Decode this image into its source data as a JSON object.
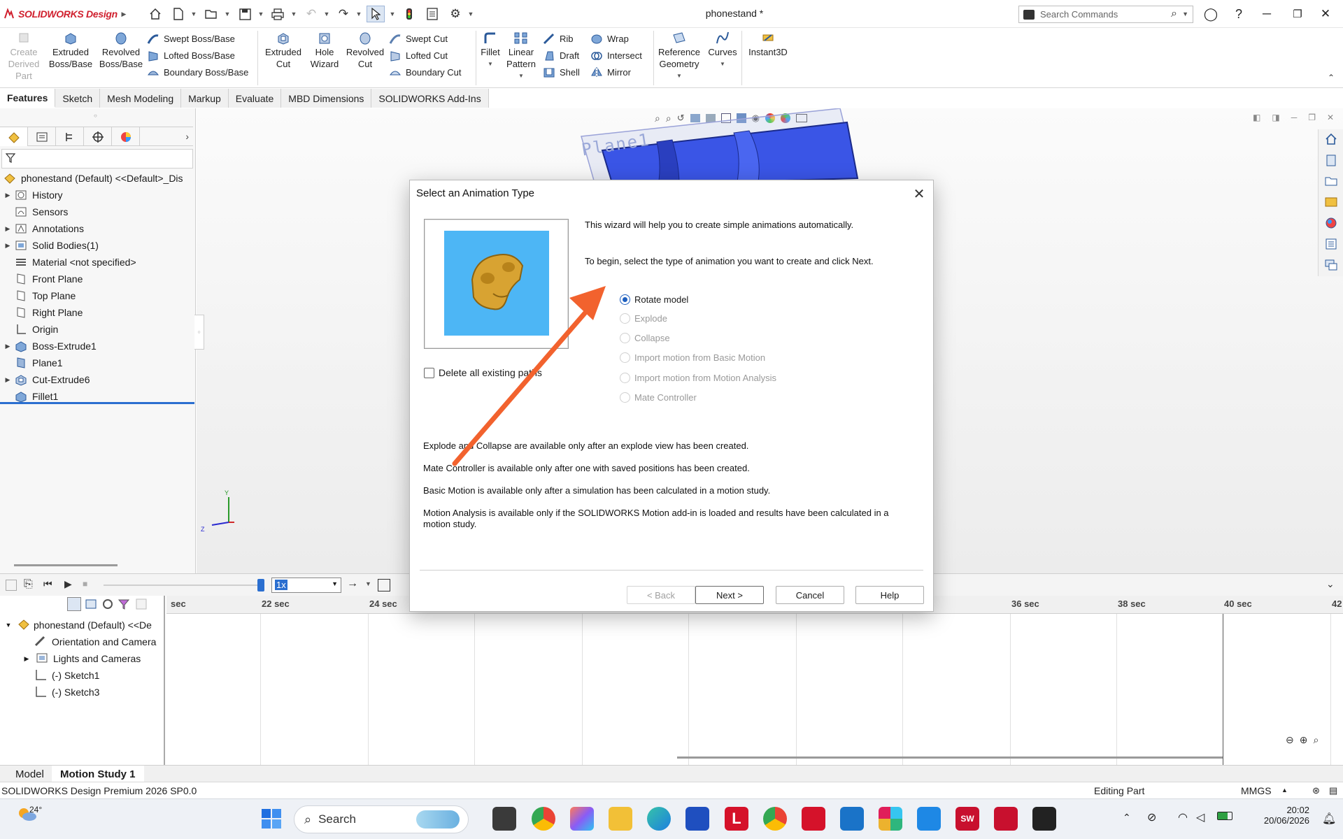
{
  "app": {
    "logo_text": "SOLIDWORKS Design",
    "document_title": "phonestand *",
    "search_placeholder": "Search Commands"
  },
  "ribbon": {
    "create_derived": "Create Derived Part",
    "extruded_boss": "Extruded Boss/Base",
    "revolved_boss": "Revolved Boss/Base",
    "swept_boss": "Swept Boss/Base",
    "lofted_boss": "Lofted Boss/Base",
    "boundary_boss": "Boundary Boss/Base",
    "extruded_cut": "Extruded Cut",
    "hole_wizard": "Hole Wizard",
    "revolved_cut": "Revolved Cut",
    "swept_cut": "Swept Cut",
    "lofted_cut": "Lofted Cut",
    "boundary_cut": "Boundary Cut",
    "fillet": "Fillet",
    "linear_pattern": "Linear Pattern",
    "rib": "Rib",
    "draft": "Draft",
    "shell": "Shell",
    "wrap": "Wrap",
    "intersect": "Intersect",
    "mirror": "Mirror",
    "reference_geometry": "Reference Geometry",
    "curves": "Curves",
    "instant3d": "Instant3D"
  },
  "tabs": [
    "Features",
    "Sketch",
    "Mesh Modeling",
    "Markup",
    "Evaluate",
    "MBD Dimensions",
    "SOLIDWORKS Add-Ins"
  ],
  "tree": {
    "root": "phonestand (Default) <<Default>_Dis",
    "items": [
      "History",
      "Sensors",
      "Annotations",
      "Solid Bodies(1)",
      "Material <not specified>",
      "Front Plane",
      "Top Plane",
      "Right Plane",
      "Origin",
      "Boss-Extrude1",
      "Plane1",
      "Cut-Extrude6",
      "Fillet1"
    ]
  },
  "graphics": {
    "plane_label": "Plane1",
    "triad_y": "Y",
    "triad_z": "Z"
  },
  "timeline": {
    "speed": "1x",
    "ruler": [
      "sec",
      "22 sec",
      "24 sec",
      "36 sec",
      "38 sec",
      "40 sec",
      "42"
    ],
    "tree": [
      "phonestand (Default) <<De",
      "Orientation and Camera",
      "Lights and Cameras",
      "(-) Sketch1",
      "(-) Sketch3"
    ]
  },
  "bottom_tabs": [
    "Model",
    "Motion Study 1"
  ],
  "status": {
    "product": "SOLIDWORKS Design Premium 2026 SP0.0",
    "mode": "Editing Part",
    "units": "MMGS"
  },
  "dialog": {
    "title": "Select an Animation Type",
    "intro1": "This wizard will help you to create simple animations automatically.",
    "intro2": "To begin, select the type of animation you want to create and click Next.",
    "options": [
      {
        "label": "Rotate model",
        "selected": true,
        "enabled": true
      },
      {
        "label": "Explode",
        "selected": false,
        "enabled": false
      },
      {
        "label": "Collapse",
        "selected": false,
        "enabled": false
      },
      {
        "label": "Import motion from Basic Motion",
        "selected": false,
        "enabled": false
      },
      {
        "label": "Import motion from Motion Analysis",
        "selected": false,
        "enabled": false
      },
      {
        "label": "Mate Controller",
        "selected": false,
        "enabled": false
      }
    ],
    "checkbox": "Delete all existing paths",
    "notes": [
      "Explode and Collapse are available only after an explode view has been created.",
      "Mate Controller is available only after one with saved positions has been created.",
      "Basic Motion is available only after a simulation has been calculated in a motion study.",
      "Motion Analysis is available only if the SOLIDWORKS Motion add-in is loaded and results have been calculated in a motion study."
    ],
    "buttons": {
      "back": "< Back",
      "next": "Next >",
      "cancel": "Cancel",
      "help": "Help"
    }
  },
  "taskbar": {
    "weather": "24°",
    "search": "Search",
    "time": "20:02",
    "date": "20/06/2026"
  },
  "colors": {
    "accent": "#1e5fbf",
    "annotation_arrow": "#f2622e",
    "preview_bg": "#4db6f5",
    "model_blue": "#3a55e6"
  }
}
